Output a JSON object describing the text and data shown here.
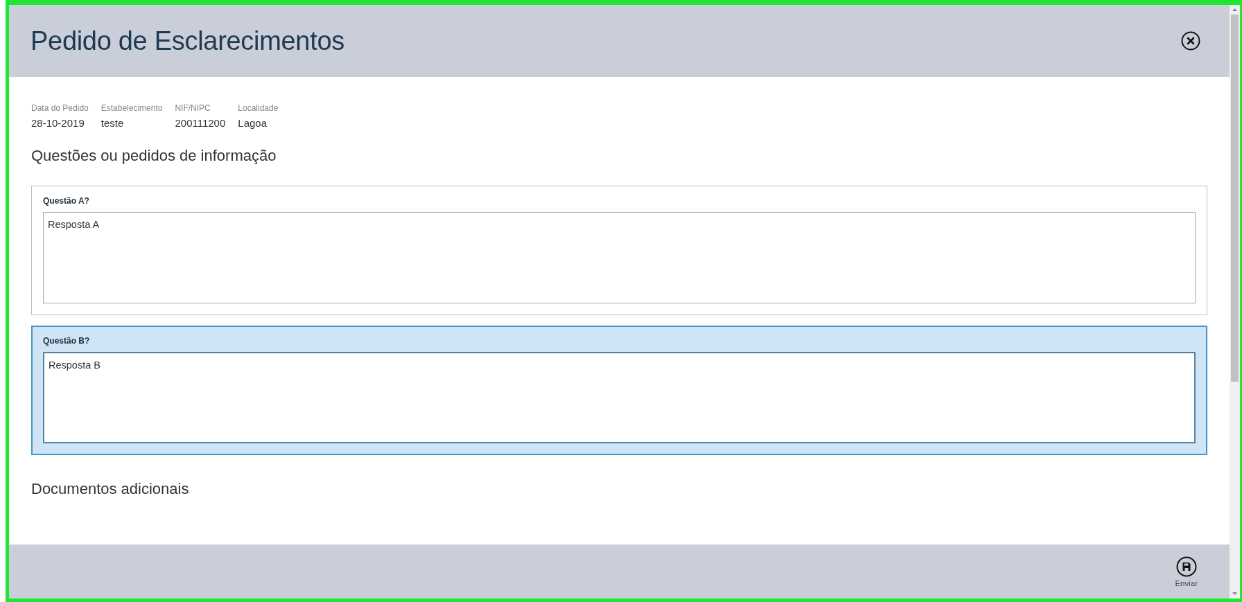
{
  "dialog": {
    "title": "Pedido de Esclarecimentos"
  },
  "details": [
    {
      "label": "Data do Pedido",
      "value": "28-10-2019"
    },
    {
      "label": "Estabelecimento",
      "value": "teste"
    },
    {
      "label": "NIF/NIPC",
      "value": "200111200"
    },
    {
      "label": "Localidade",
      "value": "Lagoa"
    }
  ],
  "questions_heading": "Questões ou pedidos de informação",
  "questions": [
    {
      "label": "Questão A?",
      "value": "Resposta A",
      "selected": false
    },
    {
      "label": "Questão B?",
      "value": "Resposta B",
      "selected": true
    }
  ],
  "documents_heading": "Documentos adicionais",
  "footer": {
    "buttons": [
      {
        "kind": "save",
        "label": "Enviar"
      }
    ]
  }
}
